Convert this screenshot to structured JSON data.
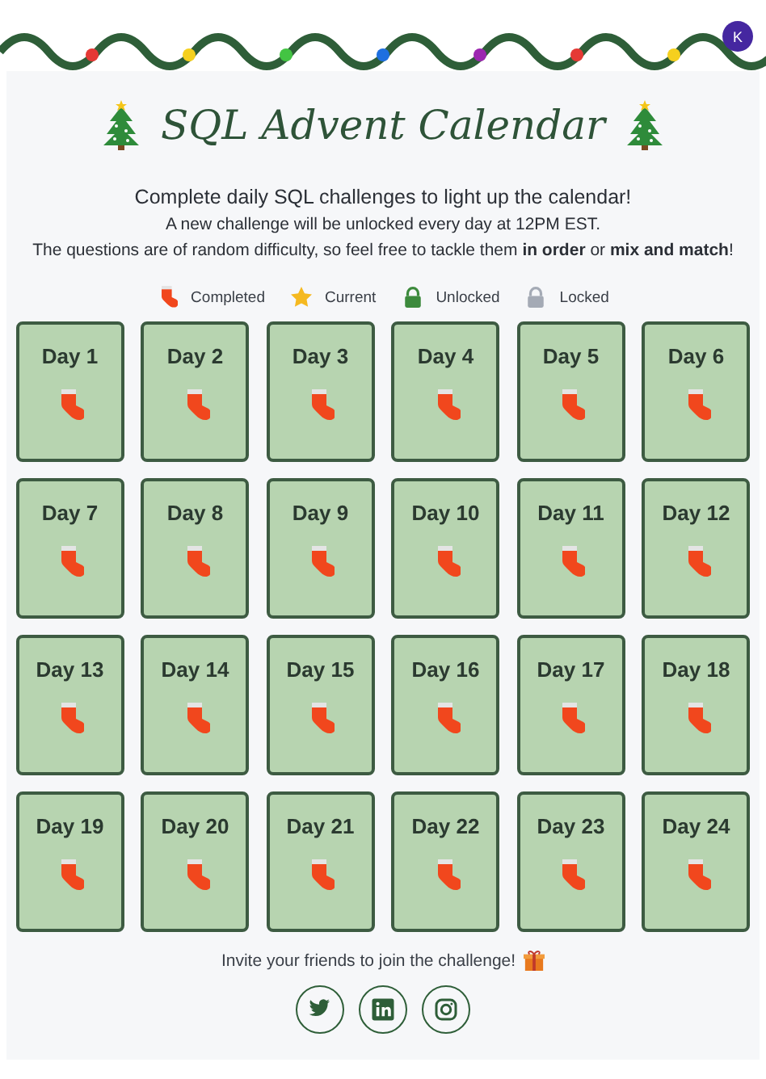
{
  "avatar": {
    "initial": "K"
  },
  "title": "SQL Advent Calendar",
  "intro": [
    "Complete daily SQL challenges to light up the calendar!",
    "A new challenge will be unlocked every day at 12PM EST.",
    "The questions are of random difficulty, so feel free to tackle them **in order** or **mix and match**!"
  ],
  "legend": [
    {
      "kind": "completed",
      "label": "Completed"
    },
    {
      "kind": "current",
      "label": "Current"
    },
    {
      "kind": "unlocked",
      "label": "Unlocked"
    },
    {
      "kind": "locked",
      "label": "Locked"
    }
  ],
  "days": [
    {
      "label": "Day 1",
      "kind": "completed"
    },
    {
      "label": "Day 2",
      "kind": "completed"
    },
    {
      "label": "Day 3",
      "kind": "completed"
    },
    {
      "label": "Day 4",
      "kind": "completed"
    },
    {
      "label": "Day 5",
      "kind": "completed"
    },
    {
      "label": "Day 6",
      "kind": "completed"
    },
    {
      "label": "Day 7",
      "kind": "completed"
    },
    {
      "label": "Day 8",
      "kind": "completed"
    },
    {
      "label": "Day 9",
      "kind": "completed"
    },
    {
      "label": "Day 10",
      "kind": "completed"
    },
    {
      "label": "Day 11",
      "kind": "completed"
    },
    {
      "label": "Day 12",
      "kind": "completed"
    },
    {
      "label": "Day 13",
      "kind": "completed"
    },
    {
      "label": "Day 14",
      "kind": "completed"
    },
    {
      "label": "Day 15",
      "kind": "completed"
    },
    {
      "label": "Day 16",
      "kind": "completed"
    },
    {
      "label": "Day 17",
      "kind": "completed"
    },
    {
      "label": "Day 18",
      "kind": "completed"
    },
    {
      "label": "Day 19",
      "kind": "completed"
    },
    {
      "label": "Day 20",
      "kind": "completed"
    },
    {
      "label": "Day 21",
      "kind": "completed"
    },
    {
      "label": "Day 22",
      "kind": "completed"
    },
    {
      "label": "Day 23",
      "kind": "completed"
    },
    {
      "label": "Day 24",
      "kind": "completed"
    }
  ],
  "invite": "Invite your friends to join the challenge!",
  "social": [
    {
      "kind": "twitter"
    },
    {
      "kind": "linkedin"
    },
    {
      "kind": "instagram"
    }
  ]
}
